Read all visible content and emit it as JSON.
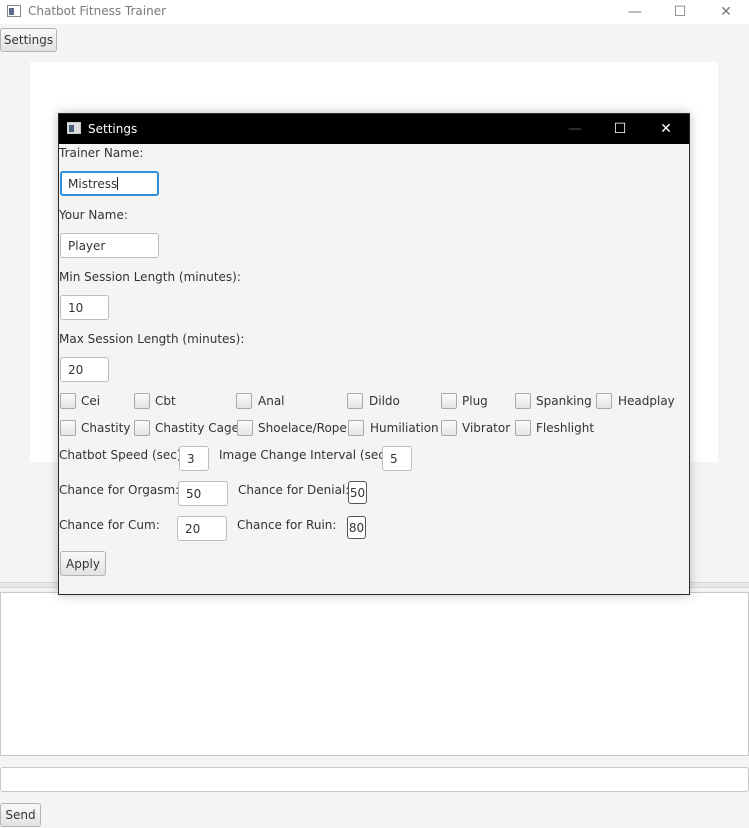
{
  "window": {
    "title": "Chatbot Fitness Trainer",
    "icon": "app-window-icon",
    "controls": {
      "minimize": "—",
      "maximize": "☐",
      "close": "✕"
    }
  },
  "toolbar": {
    "settings_label": "Settings"
  },
  "send_label": "Send",
  "dialog": {
    "title": "Settings",
    "icon": "app-window-icon",
    "controls": {
      "minimize": "—",
      "maximize": "☐",
      "close": "✕"
    },
    "trainer_name_label": "Trainer Name:",
    "trainer_name_value": "Mistress",
    "your_name_label": "Your Name:",
    "your_name_value": "Player",
    "min_session_label": "Min Session Length (minutes):",
    "min_session_value": "10",
    "max_session_label": "Max Session Length (minutes):",
    "max_session_value": "20",
    "checkboxes_row1": [
      "Cei",
      "Cbt",
      "Anal",
      "Dildo",
      "Plug",
      "Spanking",
      "Headplay"
    ],
    "checkboxes_row2": [
      "Chastity",
      "Chastity Cage",
      "Shoelace/Rope",
      "Humiliation",
      "Vibrator",
      "Fleshlight"
    ],
    "chatbot_speed_label": "Chatbot Speed (sec)",
    "chatbot_speed_value": "3",
    "image_interval_label": "Image Change Interval (sec):",
    "image_interval_value": "5",
    "orgasm_label": "Chance for Orgasm:",
    "orgasm_value": "50",
    "denial_label": "Chance for Denial:",
    "denial_value": "50",
    "cum_label": "Chance for Cum:",
    "cum_value": "20",
    "ruin_label": "Chance for Ruin:",
    "ruin_value": "80",
    "apply_label": "Apply"
  }
}
